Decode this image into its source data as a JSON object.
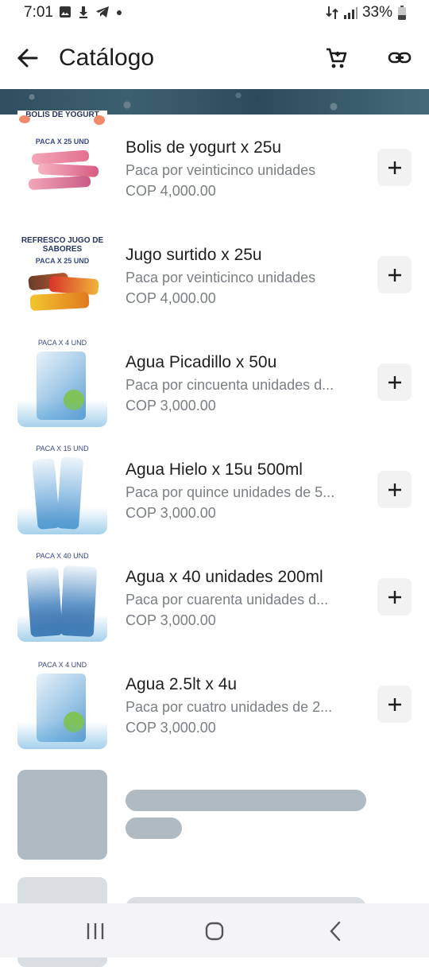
{
  "status_bar": {
    "time": "7:01",
    "battery": "33%"
  },
  "app_bar": {
    "title": "Catálogo"
  },
  "products": [
    {
      "name": "Bolis de yogurt x 25u",
      "description": "Paca por veinticinco unidades",
      "price": "COP 4,000.00",
      "thumb_caption_top": "BOLIS DE YOGURT",
      "thumb_caption": "PACA X 25 UND"
    },
    {
      "name": "Jugo surtido x 25u",
      "description": "Paca por veinticinco unidades",
      "price": "COP 4,000.00",
      "thumb_caption_top": "REFRESCO JUGO DE SABORES",
      "thumb_caption": "PACA X 25 UND"
    },
    {
      "name": "Agua Picadillo x 50u",
      "description": "Paca por cincuenta unidades d...",
      "price": "COP 3,000.00",
      "thumb_caption": "PACA X 4 UND"
    },
    {
      "name": "Agua Hielo x 15u 500ml",
      "description": "Paca por quince unidades de 5...",
      "price": "COP 3,000.00",
      "thumb_caption": "PACA X 15 UND"
    },
    {
      "name": "Agua x 40 unidades 200ml",
      "description": "Paca por cuarenta unidades d...",
      "price": "COP 3,000.00",
      "thumb_caption": "PACA X 40 UND"
    },
    {
      "name": "Agua 2.5lt x 4u",
      "description": "Paca por cuatro unidades de 2...",
      "price": "COP 3,000.00",
      "thumb_caption": "PACA X 4 UND"
    }
  ],
  "icons": {
    "back": "arrow-left-icon",
    "cart": "cart-icon",
    "link": "link-icon",
    "add": "plus-icon",
    "nav_recent": "recent-apps-icon",
    "nav_home": "home-icon",
    "nav_back": "chevron-left-icon"
  },
  "colors": {
    "skeleton": "#afbac2",
    "add_button_bg": "#f2f2f3",
    "secondary_text": "#7a7f85"
  }
}
